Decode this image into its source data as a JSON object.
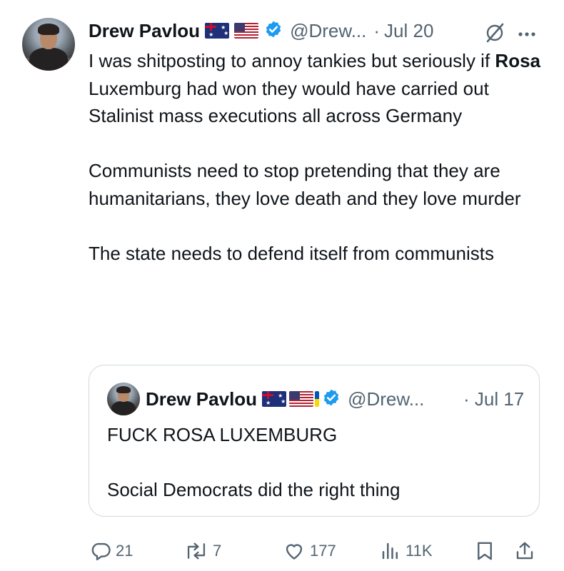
{
  "author": {
    "name": "Drew Pavlou",
    "handle": "@Drew...",
    "date_sep": "·",
    "date": "Jul 20"
  },
  "tweet": {
    "paragraphs": [
      {
        "pre": "I was shitposting to annoy tankies but seriously if ",
        "bold": "Rosa",
        "post": " Luxemburg had won they would have carried out Stalinist mass executions all across Germany"
      },
      {
        "text": "Communists need to stop pretending that they are humanitarians, they love death and they love murder"
      },
      {
        "text": "The state needs to defend itself from communists"
      }
    ]
  },
  "quote": {
    "name": "Drew Pavlou",
    "handle": "@Drew...",
    "date": "· Jul 17",
    "line1": "FUCK ROSA LUXEMBURG",
    "line2": "Social Democrats did the right thing"
  },
  "actions": {
    "replies": "21",
    "reposts": "7",
    "likes": "177",
    "views": "11K"
  },
  "icons": [
    "flag-au-icon",
    "flag-us-icon",
    "flag-ua-icon",
    "verified-badge-icon",
    "grok-icon",
    "more-icon",
    "reply-icon",
    "repost-icon",
    "like-icon",
    "views-icon",
    "bookmark-icon",
    "share-icon"
  ],
  "colors": {
    "text": "#0f1419",
    "muted": "#536471",
    "verified": "#1d9bf0",
    "border": "#cfd9de"
  }
}
